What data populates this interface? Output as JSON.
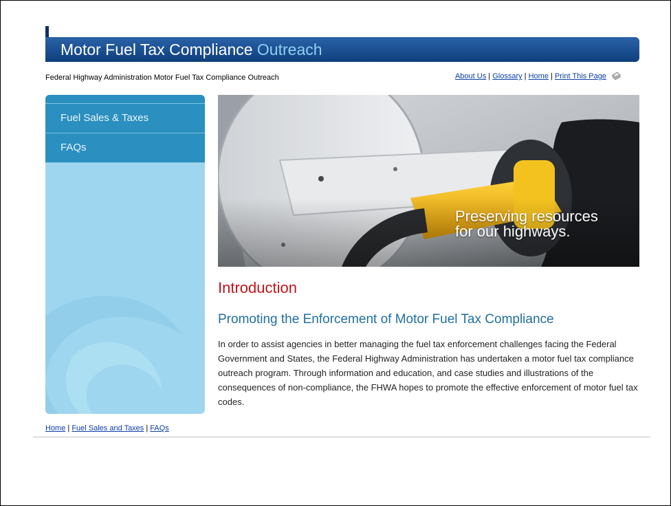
{
  "header": {
    "title_main": "Motor Fuel Tax Compliance ",
    "title_accent": "Outreach",
    "tagline": "Federal Highway Administration Motor Fuel Tax Compliance Outreach"
  },
  "utility_nav": {
    "items": [
      "About Us",
      "Glossary",
      "Home",
      "Print This Page"
    ],
    "separator": " | ",
    "print_icon": "printer-icon"
  },
  "sidebar": {
    "items": [
      {
        "label": "Fuel Sales & Taxes"
      },
      {
        "label": "FAQs"
      }
    ]
  },
  "hero": {
    "caption_line1": "Preserving resources",
    "caption_line2": "for our highways."
  },
  "content": {
    "heading": "Introduction",
    "subheading": "Promoting the Enforcement of Motor Fuel Tax Compliance",
    "paragraph": "In order to assist agencies in better managing the fuel tax enforcement challenges facing the Federal Government and States, the Federal Highway Administration has undertaken a motor fuel tax compliance outreach program. Through information and education, and case studies and illustrations of the consequences of non-compliance, the FHWA hopes to promote the effective enforcement of motor fuel tax codes."
  },
  "footer": {
    "links": [
      "Home",
      "Fuel Sales and Taxes",
      "FAQs"
    ],
    "separator": " | "
  },
  "colors": {
    "banner": "#1a4d90",
    "accent": "#8fd0f2",
    "heading_red": "#c0141b",
    "subheading_blue": "#1f6fa0",
    "sidebar_nav": "#2b8fbf",
    "sidebar_bg": "#9fd6ef"
  }
}
